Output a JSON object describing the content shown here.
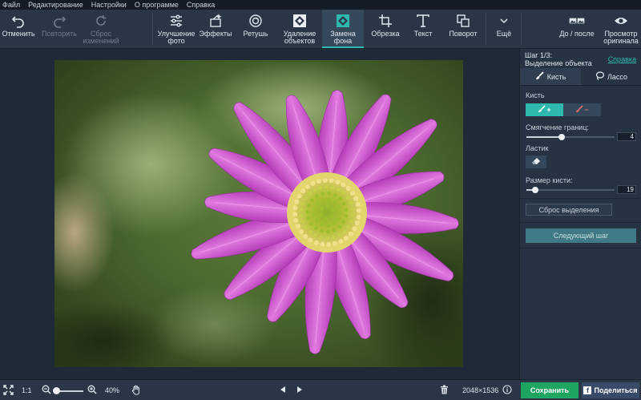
{
  "menu": [
    "Файл",
    "Редактирование",
    "Настройки",
    "О программе",
    "Справка"
  ],
  "toolbar": {
    "undo": "Отменить",
    "redo": "Повторить",
    "reset": "Сброс\nизменений",
    "enhance": "Улучшение\nфото",
    "effects": "Эффекты",
    "retouch": "Ретушь",
    "remove_objects": "Удаление\nобъектов",
    "replace_bg": "Замена\nфона",
    "crop": "Обрезка",
    "text": "Текст",
    "rotate": "Поворот",
    "more": "Ещё",
    "before_after": "До / после",
    "view_original": "Просмотр\nоригинала"
  },
  "panel": {
    "step_line1": "Шаг 1/3:",
    "step_line2": "Выделение объекта",
    "help": "Справка",
    "tab_brush": "Кисть",
    "tab_lasso": "Лассо",
    "brush_label": "Кисть",
    "brush_add": "+",
    "brush_remove": "−",
    "smoothing_label": "Смягчение границ:",
    "smoothing_value": "4",
    "smoothing_level": 0.4,
    "eraser_label": "Ластик",
    "brush_size_label": "Размер кисти:",
    "brush_size_value": "19",
    "brush_size_level": 0.1,
    "reset_selection": "Сброс выделения",
    "next_step": "Следующий шаг"
  },
  "bottom": {
    "fit": "1:1",
    "zoom": "40%",
    "zoom_level": 0.4,
    "dimensions": "2048×1536",
    "save": "Сохранить",
    "share": "Поделиться",
    "fb_icon": "f"
  },
  "colors": {
    "accent": "#2fb8ad",
    "save": "#1fa562",
    "petal": "#c13fc0"
  }
}
